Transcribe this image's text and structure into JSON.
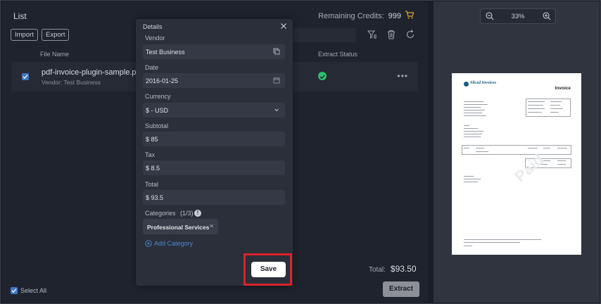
{
  "list": {
    "title": "List",
    "credits_label": "Remaining Credits:",
    "credits_value": "999",
    "import_label": "Import",
    "export_label": "Export",
    "columns": {
      "file_name": "File Name",
      "extract_status": "Extract Status"
    },
    "row": {
      "file": "pdf-invoice-plugin-sample.pdf",
      "vendor": "Vendor: Test Business"
    },
    "select_all": "Select All",
    "total_label": "Total:",
    "total_value": "$93.50",
    "extract_label": "Extract"
  },
  "preview": {
    "zoom": "33%",
    "invoice_title": "Invoice",
    "brand": "Sliced Invoices",
    "watermark": "Paid"
  },
  "details": {
    "title": "Details",
    "vendor_label": "Vendor",
    "vendor_value": "Test Business",
    "date_label": "Date",
    "date_value": "2016-01-25",
    "currency_label": "Currency",
    "currency_value": "$ - USD",
    "subtotal_label": "Subtotal",
    "subtotal_value": "$ 85",
    "tax_label": "Tax",
    "tax_value": "$ 8.5",
    "total_label": "Total",
    "total_value": "$ 93.5",
    "categories_label": "Categories",
    "categories_count": "(1/3)",
    "category_chip": "Professional Services",
    "add_category": "Add Category",
    "save_label": "Save"
  },
  "colors": {
    "accent": "#4f8ad6",
    "highlight": "#d8232a",
    "success": "#2fbf6c"
  }
}
